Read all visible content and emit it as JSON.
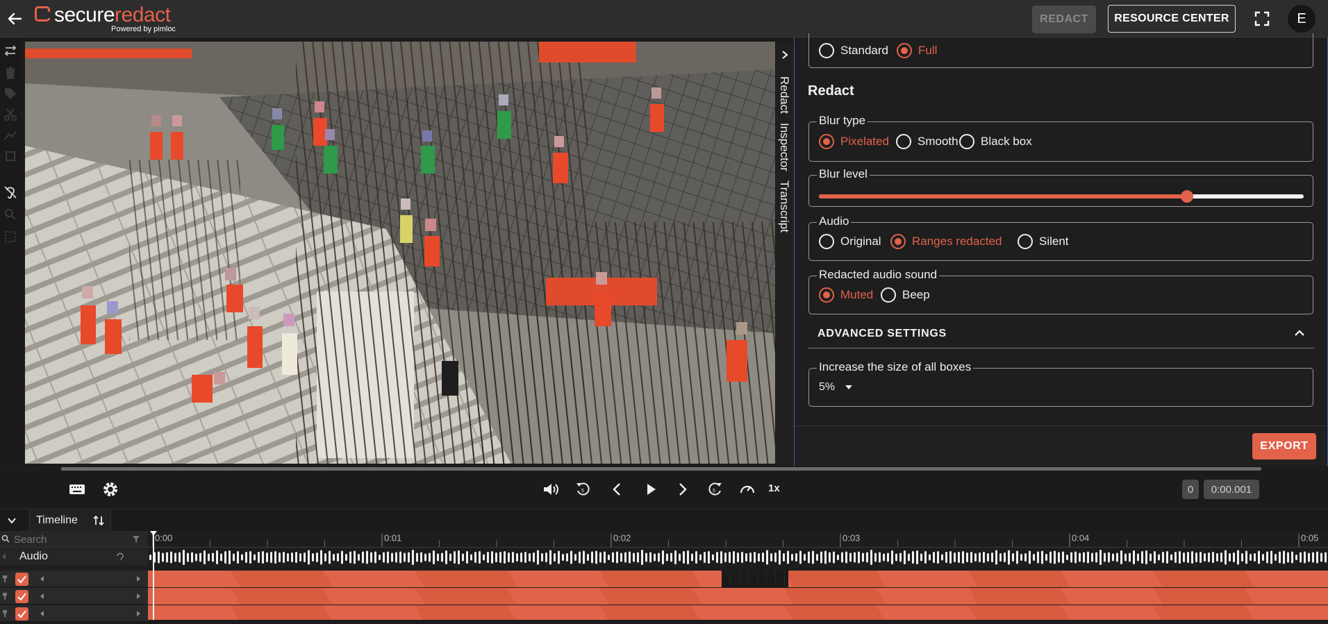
{
  "header": {
    "logo_part1": "secure",
    "logo_part2": "redact",
    "logo_sub": "Powered by pimloc",
    "redact_button": "REDACT",
    "resource_center_button": "RESOURCE CENTER",
    "avatar_initial": "E",
    "icons": [
      "back-arrow-icon",
      "fullscreen-icon"
    ]
  },
  "side_tabs": [
    "Redact",
    "Inspector",
    "Transcript"
  ],
  "panel": {
    "top_options": [
      {
        "label": "Standard",
        "selected": false
      },
      {
        "label": "Full",
        "selected": true
      }
    ],
    "section_title": "Redact",
    "blur_type": {
      "legend": "Blur type",
      "options": [
        {
          "label": "Pixelated",
          "selected": true
        },
        {
          "label": "Smooth",
          "selected": false
        },
        {
          "label": "Black box",
          "selected": false
        }
      ]
    },
    "blur_level": {
      "legend": "Blur level",
      "value": 0.76
    },
    "audio": {
      "legend": "Audio",
      "options": [
        {
          "label": "Original",
          "selected": false
        },
        {
          "label": "Ranges redacted",
          "selected": true
        },
        {
          "label": "Silent",
          "selected": false
        }
      ]
    },
    "redacted_audio_sound": {
      "legend": "Redacted audio sound",
      "options": [
        {
          "label": "Muted",
          "selected": true
        },
        {
          "label": "Beep",
          "selected": false
        }
      ]
    },
    "advanced_settings": "ADVANCED SETTINGS",
    "box_size": {
      "legend": "Increase the size of all boxes",
      "value": "5%"
    },
    "export_button": "EXPORT"
  },
  "playback": {
    "speed": "1x",
    "frame": "0",
    "time": "0:00.001",
    "progress": 0.0
  },
  "timeline": {
    "title": "Timeline",
    "search_placeholder": "Search",
    "audio_label": "Audio",
    "ticks": [
      "0:00",
      "0:01",
      "0:02",
      "0:03",
      "0:04",
      "0:05"
    ],
    "track_count": 3
  },
  "colors": {
    "accent": "#e2624a",
    "panel_border": "#3b5ba9",
    "background": "#1c1c1c"
  }
}
